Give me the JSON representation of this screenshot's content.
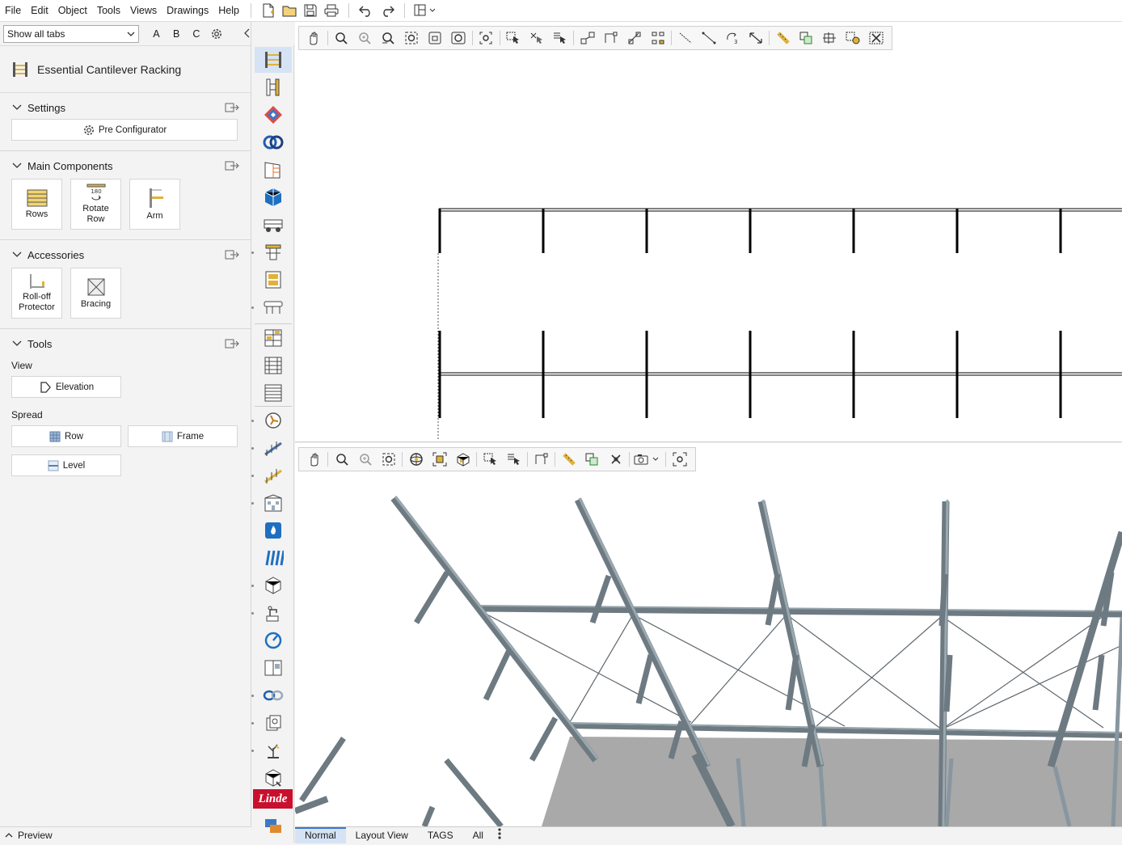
{
  "menu": {
    "items": [
      "File",
      "Edit",
      "Object",
      "Tools",
      "Views",
      "Drawings",
      "Help"
    ]
  },
  "left": {
    "tab_select": "Show all tabs",
    "letters": [
      "A",
      "B",
      "C"
    ],
    "module_title": "Essential Cantilever Racking",
    "settings": {
      "title": "Settings",
      "pre_configurator": "Pre Configurator"
    },
    "main_components": {
      "title": "Main Components",
      "rows": "Rows",
      "rotate_row_1": "Rotate",
      "rotate_row_2": "Row",
      "rotate_badge": "180",
      "arm": "Arm"
    },
    "accessories": {
      "title": "Accessories",
      "rolloff_1": "Roll-off",
      "rolloff_2": "Protector",
      "bracing": "Bracing"
    },
    "tools": {
      "title": "Tools",
      "view_label": "View",
      "elevation": "Elevation",
      "spread_label": "Spread",
      "row": "Row",
      "frame": "Frame",
      "level": "Level"
    },
    "preview": "Preview"
  },
  "bottom_tabs": [
    "Normal",
    "Layout View",
    "TAGS",
    "All"
  ],
  "vertical_brand": "Linde",
  "colors": {
    "accent": "#3b78c4",
    "active_bg": "#d5e3f5",
    "steel": "#7f8c94",
    "floor": "#a9a9a9",
    "brand_red": "#c8102e"
  }
}
